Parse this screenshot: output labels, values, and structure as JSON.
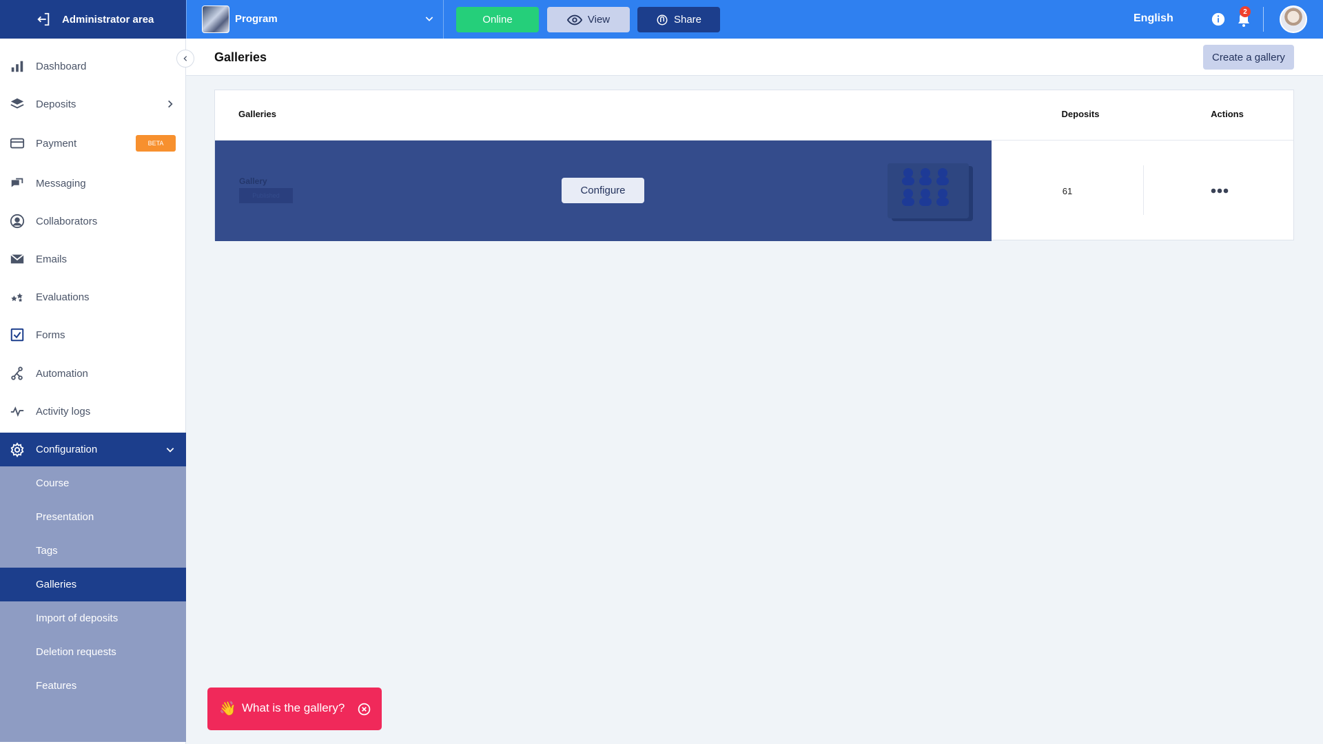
{
  "topbar": {
    "admin_area": "Administrator area",
    "program": "Program",
    "online_label": "Online",
    "view_label": "View",
    "share_label": "Share",
    "language": "English",
    "notifications_count": "2",
    "colors": {
      "bar": "#2f80f0",
      "dark": "#1c3e8c",
      "online": "#25cf7a"
    }
  },
  "sidebar": {
    "items": [
      {
        "label": "Dashboard",
        "icon": "bar-chart-icon"
      },
      {
        "label": "Deposits",
        "icon": "layers-icon"
      },
      {
        "label": "Payment",
        "icon": "credit-card-icon",
        "badge": "BETA"
      },
      {
        "label": "Messaging",
        "icon": "chat-icon"
      },
      {
        "label": "Collaborators",
        "icon": "user-circle-icon"
      },
      {
        "label": "Emails",
        "icon": "envelope-icon"
      },
      {
        "label": "Evaluations",
        "icon": "stars-icon"
      },
      {
        "label": "Forms",
        "icon": "checkbox-icon"
      },
      {
        "label": "Automation",
        "icon": "automation-icon"
      },
      {
        "label": "Activity logs",
        "icon": "pulse-icon"
      }
    ],
    "configuration": {
      "label": "Configuration",
      "sub_items": [
        "Course",
        "Presentation",
        "Tags",
        "Galleries",
        "Import of deposits",
        "Deletion requests",
        "Features"
      ],
      "active": "Galleries"
    }
  },
  "main": {
    "title": "Galleries",
    "create_button": "Create a gallery",
    "table": {
      "headers": {
        "galleries": "Galleries",
        "deposits": "Deposits",
        "actions": "Actions"
      },
      "rows": [
        {
          "name": "Gallery",
          "status": "Published",
          "configure": "Configure",
          "deposits": "61"
        }
      ]
    }
  },
  "help_toast": {
    "emoji": "👋",
    "text": "What is the gallery?"
  }
}
